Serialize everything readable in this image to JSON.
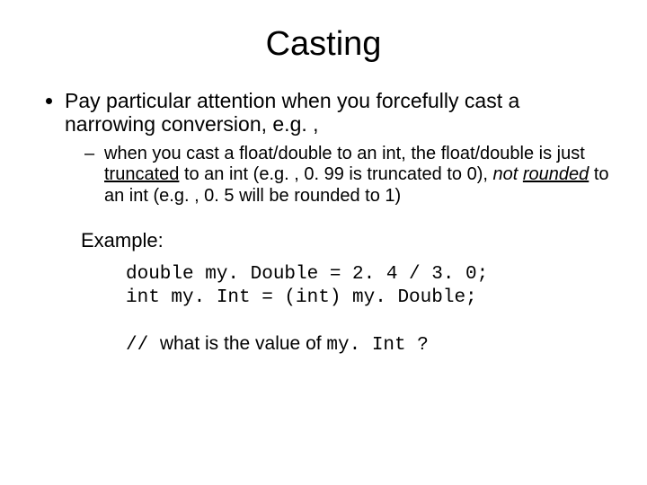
{
  "title": "Casting",
  "bullet1_a": "Pay particular attention when you forcefully cast a narrowing conversion, e.",
  "bullet1_b": "g. ,",
  "sub_a": "when you cast a float/double to an int, the float/double is just ",
  "sub_trunc": "truncated",
  "sub_b": " to an int (e.",
  "sub_c": "g. , 0. 99 is truncated to 0), ",
  "sub_not": "not",
  "sub_space": " ",
  "sub_rounded": "rounded",
  "sub_d": " to an int (e.",
  "sub_e": "g. , 0. 5 will be rounded to 1)",
  "example_label": "Example:",
  "code_line1": "double my. Double = 2. 4 / 3. 0;",
  "code_line2": "int my. Int = (int) my. Double;",
  "q_prefix": "// ",
  "q_text": "what is the value of ",
  "q_code": "my. Int ",
  "q_mark": "?"
}
